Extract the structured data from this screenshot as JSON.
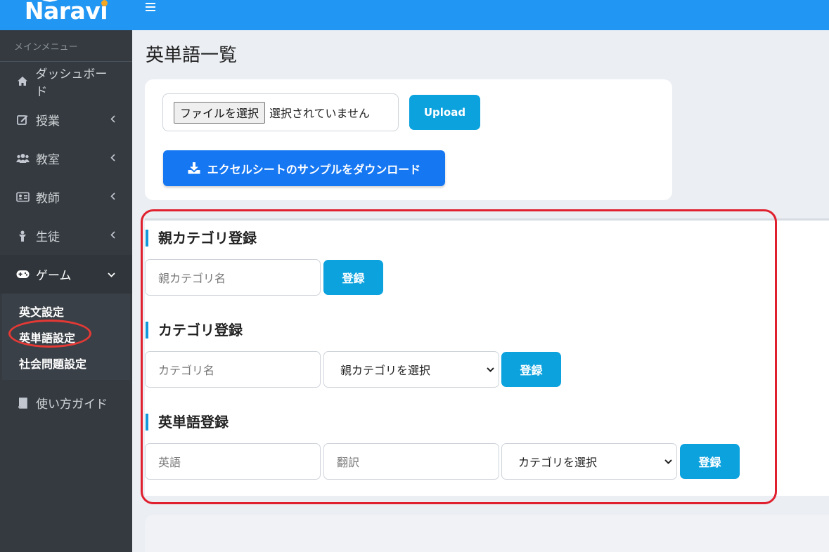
{
  "brand": {
    "name": "Naravi"
  },
  "sidebar": {
    "header": "メインメニュー",
    "items": [
      {
        "label": "ダッシュボード",
        "icon": "home-icon"
      },
      {
        "label": "授業",
        "icon": "edit-icon"
      },
      {
        "label": "教室",
        "icon": "users-icon"
      },
      {
        "label": "教師",
        "icon": "id-card-icon"
      },
      {
        "label": "生徒",
        "icon": "student-icon"
      },
      {
        "label": "ゲーム",
        "icon": "gamepad-icon"
      }
    ],
    "sub_items": [
      {
        "label": "英文設定"
      },
      {
        "label": "英単語設定"
      },
      {
        "label": "社会問題設定"
      }
    ],
    "guide": {
      "label": "使い方ガイド",
      "icon": "book-icon"
    }
  },
  "main": {
    "title": "英単語一覧",
    "upload": {
      "file_button": "ファイルを選択",
      "file_status": "選択されていません",
      "upload_button": "Upload",
      "download_button": "エクセルシートのサンプルをダウンロード"
    },
    "parent_category": {
      "title": "親カテゴリ登録",
      "name_placeholder": "親カテゴリ名",
      "submit": "登録"
    },
    "category": {
      "title": "カテゴリ登録",
      "name_placeholder": "カテゴリ名",
      "parent_select": "親カテゴリを選択",
      "submit": "登録"
    },
    "word": {
      "title": "英単語登録",
      "english_placeholder": "英語",
      "translation_placeholder": "翻訳",
      "category_select": "カテゴリを選択",
      "submit": "登録"
    }
  },
  "colors": {
    "primary": "#2196f3",
    "accent": "#0ba2de",
    "download": "#1677f2",
    "sidebar": "#343a40",
    "highlight": "#e0202e"
  }
}
